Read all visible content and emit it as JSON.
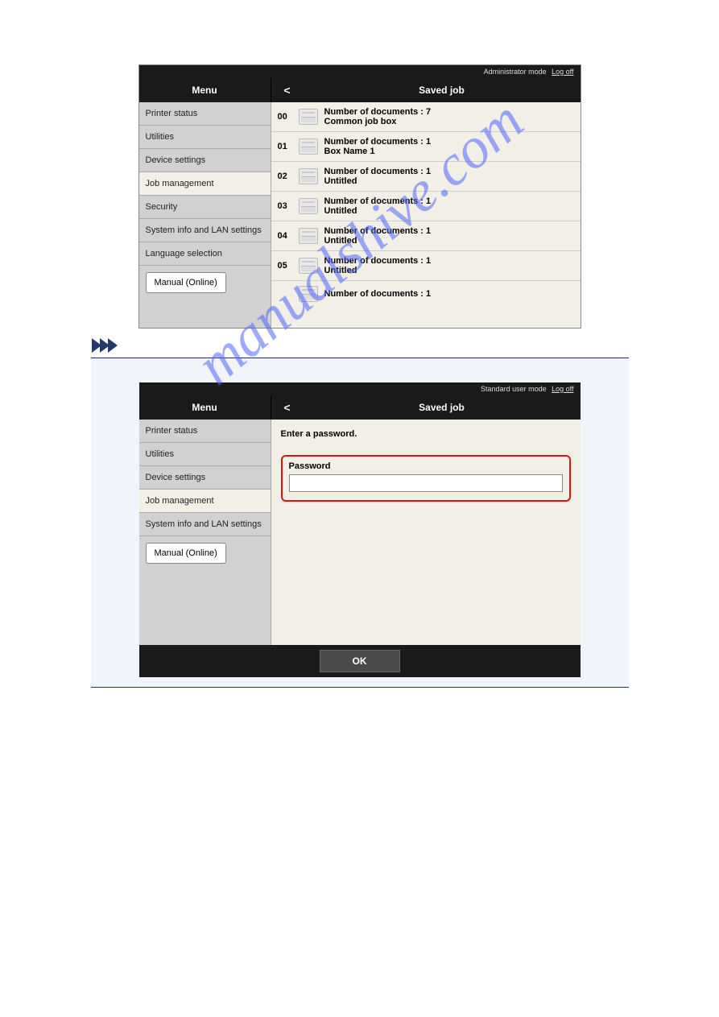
{
  "watermark": "manualshive.com",
  "screen1": {
    "topbar": {
      "mode": "Administrator mode",
      "logoff": "Log off"
    },
    "header": {
      "menu": "Menu",
      "back": "<",
      "title": "Saved job"
    },
    "sidebar": {
      "items": [
        {
          "label": "Printer status",
          "active": false
        },
        {
          "label": "Utilities",
          "active": false
        },
        {
          "label": "Device settings",
          "active": false
        },
        {
          "label": "Job management",
          "active": true
        },
        {
          "label": "Security",
          "active": false
        },
        {
          "label": "System info and LAN settings",
          "active": false
        },
        {
          "label": "Language selection",
          "active": false
        }
      ],
      "manual": "Manual (Online)"
    },
    "jobs": [
      {
        "idx": "00",
        "docs": "Number of documents : 7",
        "name": "Common job box"
      },
      {
        "idx": "01",
        "docs": "Number of documents : 1",
        "name": "Box Name 1"
      },
      {
        "idx": "02",
        "docs": "Number of documents : 1",
        "name": "Untitled"
      },
      {
        "idx": "03",
        "docs": "Number of documents : 1",
        "name": "Untitled"
      },
      {
        "idx": "04",
        "docs": "Number of documents : 1",
        "name": "Untitled"
      },
      {
        "idx": "05",
        "docs": "Number of documents : 1",
        "name": "Untitled"
      },
      {
        "idx": "",
        "docs": "Number of documents : 1",
        "name": ""
      }
    ]
  },
  "screen2": {
    "topbar": {
      "mode": "Standard user mode",
      "logoff": "Log off"
    },
    "header": {
      "menu": "Menu",
      "back": "<",
      "title": "Saved job"
    },
    "sidebar": {
      "items": [
        {
          "label": "Printer status",
          "active": false
        },
        {
          "label": "Utilities",
          "active": false
        },
        {
          "label": "Device settings",
          "active": false
        },
        {
          "label": "Job management",
          "active": true
        },
        {
          "label": "System info and LAN settings",
          "active": false
        }
      ],
      "manual": "Manual (Online)"
    },
    "password": {
      "prompt": "Enter a password.",
      "label": "Password",
      "ok": "OK"
    }
  }
}
